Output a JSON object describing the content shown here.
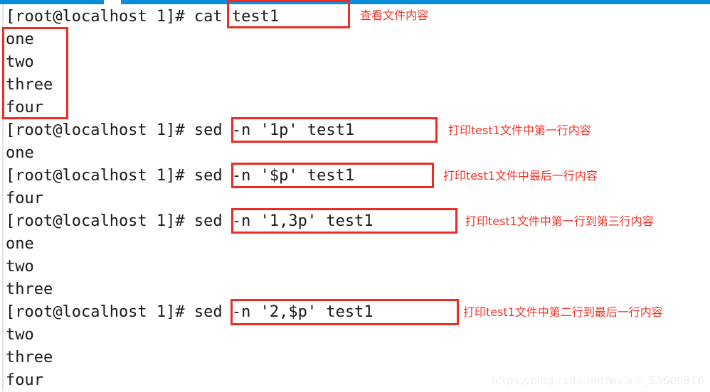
{
  "window": {
    "titlebar_color": "#0a8ddb",
    "background_color": "#ffffff",
    "text_color": "#1a1a1a",
    "highlight_color": "#ee2b24",
    "annotation_color": "#ee3326"
  },
  "terminal": {
    "prompt": "[root@localhost 1]# ",
    "lines": [
      {
        "type": "prompt",
        "prompt": "[root@localhost 1]# ",
        "command": "cat test1"
      },
      {
        "type": "output",
        "text": "one"
      },
      {
        "type": "output",
        "text": "two"
      },
      {
        "type": "output",
        "text": "three"
      },
      {
        "type": "output",
        "text": "four"
      },
      {
        "type": "prompt",
        "prompt": "[root@localhost 1]# ",
        "command": "sed -n '1p' test1"
      },
      {
        "type": "output",
        "text": "one"
      },
      {
        "type": "prompt",
        "prompt": "[root@localhost 1]# ",
        "command": "sed -n '$p' test1"
      },
      {
        "type": "output",
        "text": "four"
      },
      {
        "type": "prompt",
        "prompt": "[root@localhost 1]# ",
        "command": "sed -n '1,3p' test1"
      },
      {
        "type": "output",
        "text": "one"
      },
      {
        "type": "output",
        "text": "two"
      },
      {
        "type": "output",
        "text": "three"
      },
      {
        "type": "prompt",
        "prompt": "[root@localhost 1]# ",
        "command": "sed -n '2,$p' test1"
      },
      {
        "type": "output",
        "text": "two"
      },
      {
        "type": "output",
        "text": "three"
      },
      {
        "type": "output",
        "text": "four"
      }
    ]
  },
  "annotations": [
    {
      "id": "annot-cat",
      "text": "查看文件内容"
    },
    {
      "id": "annot-first",
      "text": "打印test1文件中第一行内容"
    },
    {
      "id": "annot-last",
      "text": "打印test1文件中最后一行内容"
    },
    {
      "id": "annot-range",
      "text": "打印test1文件中第一行到第三行内容"
    },
    {
      "id": "annot-to-end",
      "text": "打印test1文件中第二行到最后一行内容"
    }
  ],
  "watermark": {
    "text": "https://blog.csdn.net/weixin_55609816"
  }
}
